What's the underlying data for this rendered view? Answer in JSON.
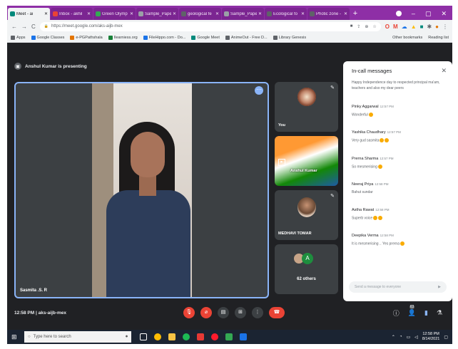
{
  "tabs": [
    {
      "label": "Meet - ai",
      "active": true,
      "color": "#00897b"
    },
    {
      "label": "Inbox - akhil",
      "active": false,
      "color": "#ea4335"
    },
    {
      "label": "Green Olymp",
      "active": false,
      "color": "#34a853"
    },
    {
      "label": "Sample_Pape",
      "active": false,
      "color": "#9aa0a6"
    },
    {
      "label": "geological fe",
      "active": false,
      "color": "#5f6368"
    },
    {
      "label": "Sample_Pape",
      "active": false,
      "color": "#9aa0a6"
    },
    {
      "label": "Ecological fo",
      "active": false,
      "color": "#5f6368"
    },
    {
      "label": "Photic zone -",
      "active": false,
      "color": "#5f6368"
    }
  ],
  "tab_new_label": "+",
  "window": {
    "minimize": "–",
    "maximize": "▢",
    "close": "✕"
  },
  "address": {
    "url": "https://meet.google.com/aks-aijb-mex",
    "back": "←",
    "forward": "→",
    "reload": "C",
    "lock": "🔒"
  },
  "bookmarks": [
    {
      "label": "Apps",
      "color": "#5f6368"
    },
    {
      "label": "Google Classes",
      "color": "#1a73e8"
    },
    {
      "label": "e-PGPathshala",
      "color": "#e37400"
    },
    {
      "label": "Ilearniess.org",
      "color": "#188038"
    },
    {
      "label": "FileHippo.com - Do...",
      "color": "#1a73e8"
    },
    {
      "label": "Google Meet",
      "color": "#00897b"
    },
    {
      "label": "AnimeOut - Free D...",
      "color": "#5f6368"
    },
    {
      "label": "Library Genesis",
      "color": "#5f6368"
    }
  ],
  "bookmarks_right": [
    "Other bookmarks",
    "Reading list"
  ],
  "presenter_banner": "Anshul Kumar is presenting",
  "main_tile": {
    "name": "Sasmita .S. R",
    "more": "⋯"
  },
  "side_tiles": [
    {
      "name": "You"
    },
    {
      "name": "Anshul Kumar"
    },
    {
      "name": "MEDHAVI TOMAR"
    },
    {
      "name": "62 others",
      "avatar_letter": "A"
    }
  ],
  "chat": {
    "title": "In-call messages",
    "close": "✕",
    "first_text": "Happy Independence day to respected principal ma'am, teachers and also my dear peers",
    "messages": [
      {
        "who": "Pinky Aggarwal",
        "when": "12:57 PM",
        "text": "Wonderful"
      },
      {
        "who": "Yashika Chaudhary",
        "when": "12:57 PM",
        "text": "Very gud sasmita"
      },
      {
        "who": "Prerna Sharma",
        "when": "12:57 PM",
        "text": "So mesmerising"
      },
      {
        "who": "Neeraj Priya",
        "when": "12:58 PM",
        "text": "Bahut sundar"
      },
      {
        "who": "Astha Rawat",
        "when": "12:58 PM",
        "text": "Superb voice"
      },
      {
        "who": "Deepika Verma",
        "when": "12:58 PM",
        "text": "It is mesmerising .. Yes prerna"
      }
    ],
    "input_placeholder": "Send a message to everyone",
    "send": "▶"
  },
  "meeting_info": {
    "time": "12:58 PM",
    "separator": "|",
    "code": "aks-aijb-mex"
  },
  "controls": {
    "mic": "🎙",
    "cam": "⌀",
    "captions": "▤",
    "present": "⊞",
    "more": "⋮",
    "end": "☎"
  },
  "right_controls": {
    "info": "ⓘ",
    "people": "👤",
    "people_count": "63",
    "chat": "▮",
    "activities": "⚗"
  },
  "taskbar": {
    "start": "⊞",
    "search_placeholder": "Type here to search",
    "time": "12:58 PM",
    "date": "8/14/2021"
  },
  "colors": {
    "tab_strip": "#8e2fa6",
    "meet_bg": "#202124",
    "tile_active_border": "#8ab4f8",
    "end_call": "#ea4335"
  }
}
